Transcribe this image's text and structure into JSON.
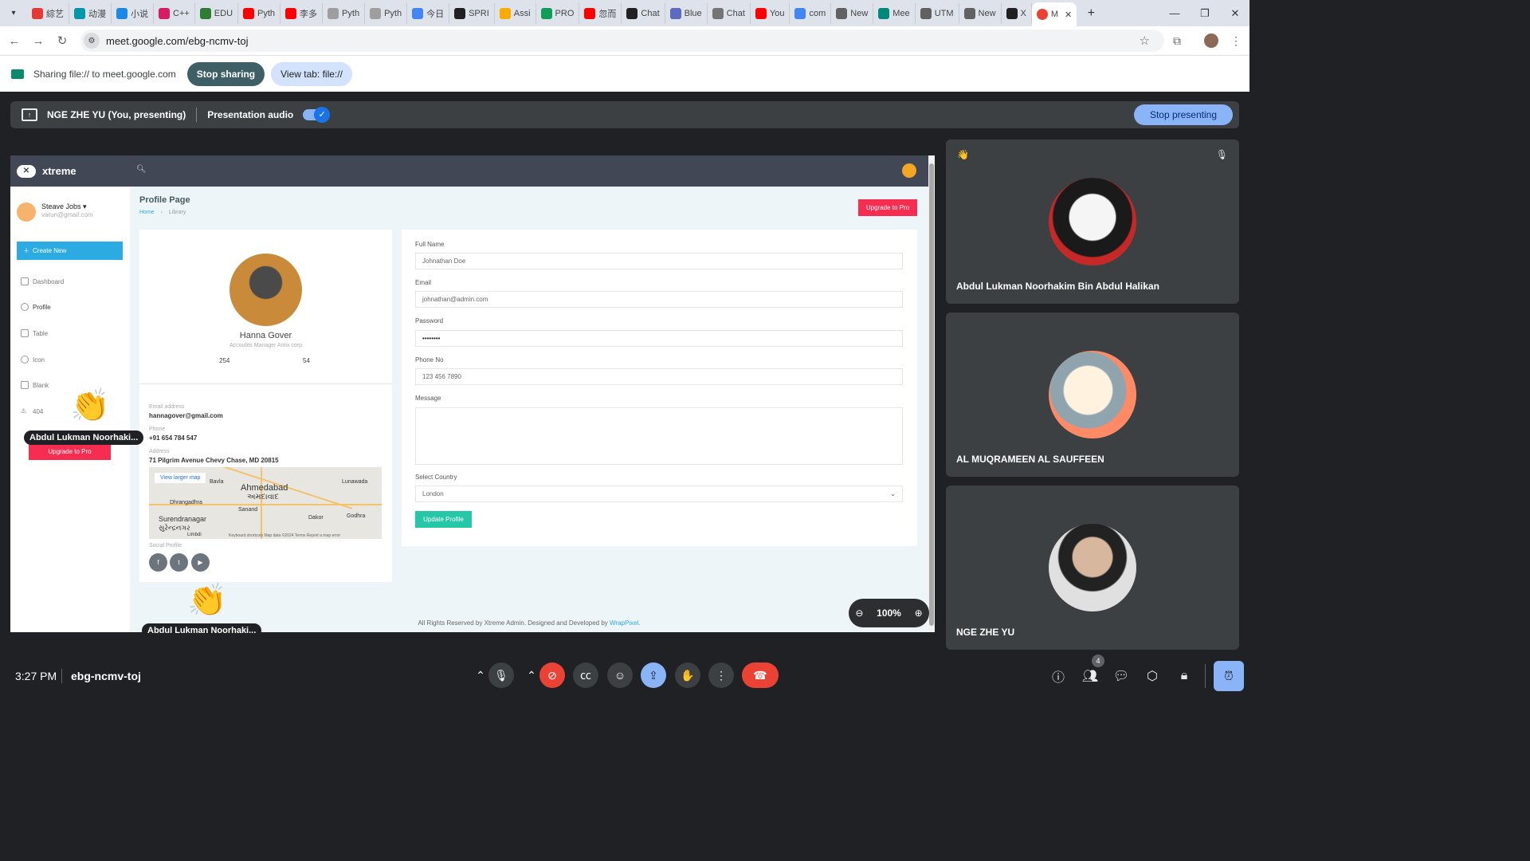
{
  "browser": {
    "tabs": [
      {
        "label": "綜艺",
        "color": "#e53935"
      },
      {
        "label": "动漫",
        "color": "#0097a7"
      },
      {
        "label": "小说",
        "color": "#1e88e5"
      },
      {
        "label": "C++",
        "color": "#d81b60"
      },
      {
        "label": "EDU",
        "color": "#2e7d32"
      },
      {
        "label": "Pyth",
        "color": "#ff0000"
      },
      {
        "label": "李多",
        "color": "#ff0000"
      },
      {
        "label": "Pyth",
        "color": "#9e9e9e"
      },
      {
        "label": "Pyth",
        "color": "#9e9e9e"
      },
      {
        "label": "今日",
        "color": "#4285f4"
      },
      {
        "label": "SPRI",
        "color": "#212121"
      },
      {
        "label": "Assi",
        "color": "#f9ab00"
      },
      {
        "label": "PRO",
        "color": "#0f9d58"
      },
      {
        "label": "忽而",
        "color": "#ff0000"
      },
      {
        "label": "Chat",
        "color": "#212121"
      },
      {
        "label": "Blue",
        "color": "#5c6bc0"
      },
      {
        "label": "Chat",
        "color": "#757575"
      },
      {
        "label": "You",
        "color": "#ff0000"
      },
      {
        "label": "com",
        "color": "#4285f4"
      },
      {
        "label": "New",
        "color": "#616161"
      },
      {
        "label": "Mee",
        "color": "#00897b"
      },
      {
        "label": "UTM",
        "color": "#616161"
      },
      {
        "label": "New",
        "color": "#616161"
      },
      {
        "label": "X",
        "color": "#212121"
      }
    ],
    "active_tab_label": "M",
    "url": "meet.google.com/ebg-ncmv-toj"
  },
  "sharebar": {
    "text": "Sharing file:// to meet.google.com",
    "stop_label": "Stop sharing",
    "view_label": "View tab: file://"
  },
  "presbar": {
    "name": "NGE ZHE YU (You, presenting)",
    "audio_label": "Presentation audio",
    "stop_label": "Stop presenting"
  },
  "screen": {
    "brand": "xtreme",
    "user_name": "Steave Jobs",
    "user_email": "varun@gmail.com",
    "create_label": "Create New",
    "nav": [
      "Dashboard",
      "Profile",
      "Table",
      "Icon",
      "Blank",
      "404"
    ],
    "upgrade_label": "Upgrade to Pro",
    "page_title": "Profile Page",
    "crumb_home": "Home",
    "crumb_current": "Library",
    "profile_name": "Hanna Gover",
    "profile_role": "Accoubts Manager Amix corp",
    "stat_1": "254",
    "stat_2": "54",
    "email_label": "Email address",
    "email_value": "hannagover@gmail.com",
    "phone_label": "Phone",
    "phone_value": "+91 654 784 547",
    "address_label": "Address",
    "address_value": "71 Pilgrim Avenue Chevy Chase, MD 20815",
    "map_button": "View larger map",
    "map_city_1": "Ahmedabad",
    "map_city_1_local": "અમદાવાદ",
    "map_city_2": "Surendranagar",
    "map_city_2_local": "સુરેન્દ્રનગર",
    "map_city_3": "Dhrangadhra",
    "map_city_4": "Sanand",
    "map_city_5": "Lunawada",
    "map_city_6": "Dakor",
    "map_city_7": "Godhra",
    "map_city_8": "Limbdi",
    "map_city_9": "Bavla",
    "map_footer": "Keyboard shortcuts   Map data ©2024   Terms   Report a map error",
    "social_label": "Social Profile",
    "form": {
      "fullname_label": "Full Name",
      "fullname_value": "Johnathan Doe",
      "email_label": "Email",
      "email_value": "johnathan@admin.com",
      "password_label": "Password",
      "password_value": "••••••••",
      "phone_label": "Phone No",
      "phone_value": "123 456 7890",
      "message_label": "Message",
      "country_label": "Select Country",
      "country_value": "London",
      "update_label": "Update Profile"
    },
    "footer_text": "All Rights Reserved by Xtreme Admin. Designed and Developed by ",
    "footer_link": "WrapPixel."
  },
  "reactions": [
    {
      "emoji": "👏",
      "name": "Abdul Lukman Noorhaki..."
    },
    {
      "emoji": "👏",
      "name": "Abdul Lukman Noorhaki..."
    }
  ],
  "zoom_level": "100%",
  "participants": [
    {
      "name": "Abdul Lukman Noorhakim Bin Abdul Halikan",
      "hand": "👋"
    },
    {
      "name": "AL MUQRAMEEN AL SAUFFEEN"
    },
    {
      "name": "NGE ZHE YU"
    }
  ],
  "bottombar": {
    "time": "3:27 PM",
    "meeting_code": "ebg-ncmv-toj",
    "people_count": "4"
  }
}
